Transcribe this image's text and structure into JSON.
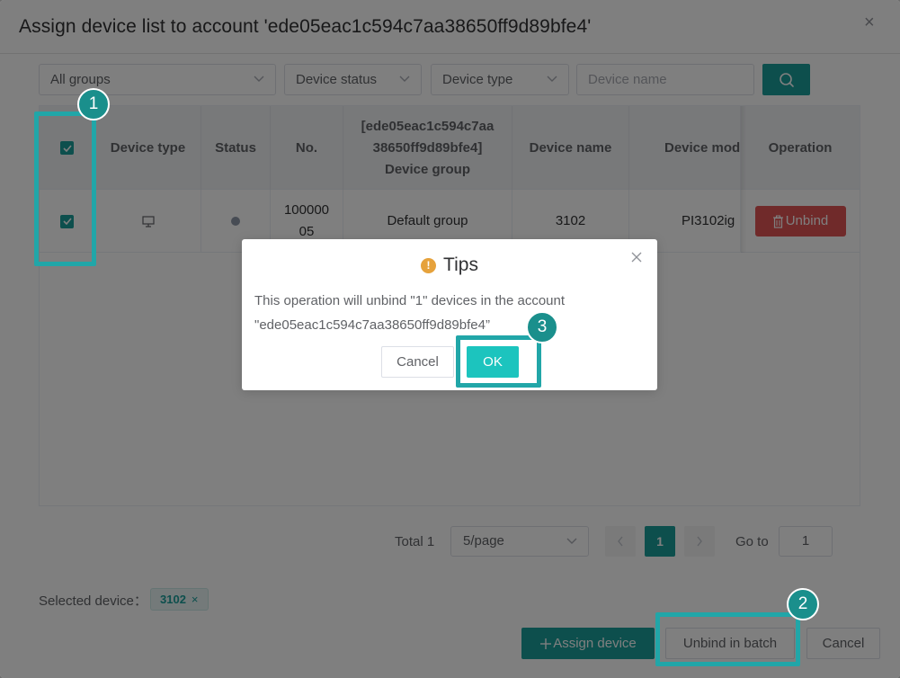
{
  "dialog": {
    "title": "Assign device list to account 'ede05eac1c594c7aa38650ff9d89bfe4'",
    "close_icon": "×"
  },
  "filters": {
    "group": "All groups",
    "status": "Device status",
    "type": "Device type",
    "name_placeholder": "Device name",
    "search_icon": "search-icon"
  },
  "table": {
    "headers": {
      "device_type": "Device type",
      "status": "Status",
      "no": "No.",
      "group_line1": "[ede05eac1c594c7aa",
      "group_line2": "38650ff9d89bfe4]",
      "group_line3": "Device group",
      "device_name": "Device name",
      "device_model": "Device mod",
      "operation": "Operation"
    },
    "rows": [
      {
        "no_line1": "100000",
        "no_line2": "05",
        "group": "Default group",
        "device_name": "3102",
        "device_model": "PI3102ig",
        "unbind": "Unbind"
      }
    ]
  },
  "pagination": {
    "total": "Total 1",
    "page_size": "5/page",
    "current_page": "1",
    "goto_label": "Go to",
    "goto_value": "1"
  },
  "selected": {
    "label": "Selected device：",
    "tag": "3102",
    "tag_remove": "×"
  },
  "footer": {
    "assign": "Assign device",
    "unbind_batch": "Unbind in batch",
    "cancel": "Cancel"
  },
  "tips": {
    "title": "Tips",
    "line1": "This operation will unbind \"1\" devices in the account",
    "line2": "\"ede05eac1c594c7aa38650ff9d89bfe4”",
    "cancel": "Cancel",
    "ok": "OK"
  },
  "annotations": {
    "step1": "1",
    "step2": "2",
    "step3": "3"
  },
  "colors": {
    "accent": "#1a9e9a",
    "danger": "#e05454",
    "warning": "#e6a23c"
  }
}
